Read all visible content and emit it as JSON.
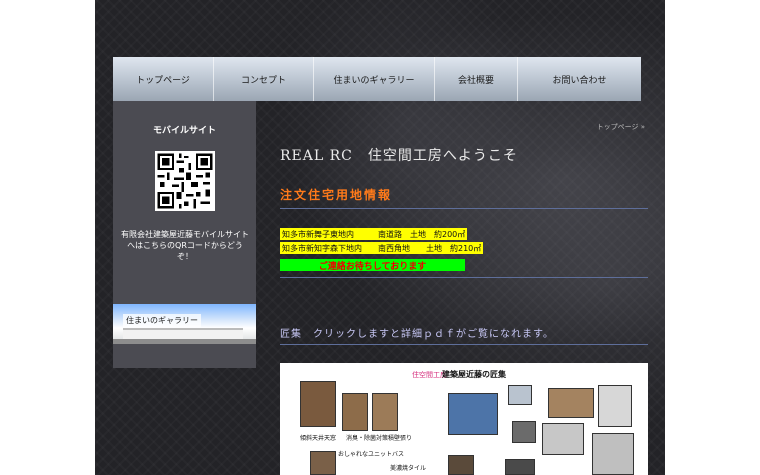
{
  "nav": {
    "items": [
      {
        "label": "トップページ"
      },
      {
        "label": "コンセプト"
      },
      {
        "label": "住まいのギャラリー"
      },
      {
        "label": "会社概要"
      },
      {
        "label": "お問い合わせ"
      }
    ]
  },
  "sidebar": {
    "title": "モバイルサイト",
    "description": "有限会社建築屋近藤モバイルサイトへはこちらのQRコードからどうぞ！",
    "gallery_banner_label": "住まいのギャラリー"
  },
  "breadcrumb": "トップページ »",
  "main": {
    "title": "REAL RC　住空間工房へようこそ",
    "land_heading": "注文住宅用地情報",
    "land_rows": [
      {
        "text": "知多市新舞子東地内　　　南道路　土地　約200㎡"
      },
      {
        "text": "知多市新知字森下地内　　南西角地　　土地　約210㎡"
      }
    ],
    "contact_text": "ご連絡お待ちしております",
    "takumi_heading": "匠集　クリックしますと詳細ｐｄｆがご覧になれます。",
    "pdf": {
      "brand": "住空間工房",
      "title": "建築屋近藤の匠集",
      "captions": [
        "傾斜天井天窓",
        "消臭・除菌対策積壁張り",
        "おしゃれなユニットバス",
        "美濃焼タイル"
      ]
    },
    "colors": {
      "accent_orange": "#ff7a1a",
      "highlight_yellow": "#ffff00",
      "highlight_green": "#00ff00",
      "contact_red": "#e00000"
    }
  }
}
